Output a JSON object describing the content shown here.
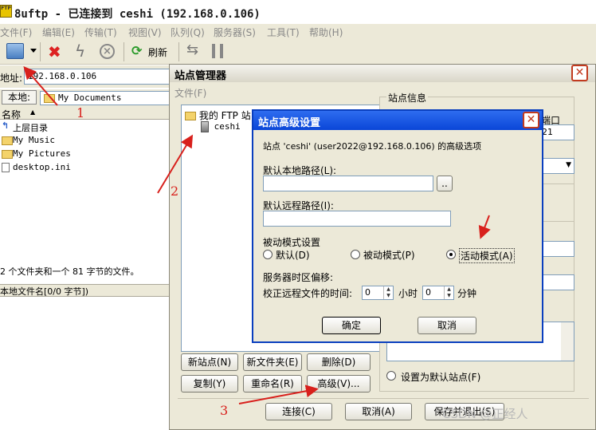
{
  "window": {
    "title": "8uftp - 已连接到 ceshi (192.168.0.106)",
    "app_icon_text": "FTP"
  },
  "menubar": [
    "文件(F)",
    "编辑(E)",
    "传输(T)",
    "视图(V)",
    "队列(Q)",
    "服务器(S)",
    "工具(T)",
    "帮助(H)"
  ],
  "toolbar": {
    "refresh_label": "刷新"
  },
  "address": {
    "label": "地址:",
    "value": "192.168.0.106"
  },
  "local": {
    "label": "本地:",
    "path": "My Documents",
    "column_name": "名称",
    "files": [
      "上层目录",
      "My Music",
      "My Pictures",
      "desktop.ini"
    ],
    "summary": "2 个文件夹和一个 81 字节的文件。",
    "bottom_header": "本地文件名[0/0 字节])"
  },
  "site_manager": {
    "title": "站点管理器",
    "menu": "文件(F)",
    "tree_root": "我的 FTP 站",
    "tree_child": "ceshi",
    "site_info_label": "站点信息",
    "port_label": "端口",
    "port_value": "21",
    "buttons": {
      "new_site": "新站点(N)",
      "new_folder": "新文件夹(E)",
      "delete": "删除(D)",
      "copy": "复制(Y)",
      "rename": "重命名(R)",
      "advanced": "高级(V)...",
      "connect": "连接(C)",
      "cancel": "取消(A)",
      "save_exit": "保存并退出(S)"
    },
    "default_site": "设置为默认站点(F)"
  },
  "advanced": {
    "title": "站点高级设置",
    "subtitle": "站点 'ceshi' (user2022@192.168.0.106) 的高级选项",
    "local_path_label": "默认本地路径(L):",
    "local_path_value": "",
    "browse": "..",
    "remote_path_label": "默认远程路径(I):",
    "remote_path_value": "",
    "passive_label": "被动模式设置",
    "mode_default": "默认(D)",
    "mode_passive": "被动模式(P)",
    "mode_active": "活动模式(A)",
    "tz_label": "服务器时区偏移:",
    "tz_correct": "校正远程文件的时间:",
    "hours_value": "0",
    "hours_unit": "小时",
    "minutes_value": "0",
    "minutes_unit": "分钟",
    "ok": "确定",
    "cancel": "取消"
  },
  "annotations": {
    "n1": "1",
    "n2": "2",
    "n3": "3"
  },
  "watermark": "CSDN @正经人",
  "accent_color": "#0a46d8",
  "annotation_color": "#d8201c"
}
